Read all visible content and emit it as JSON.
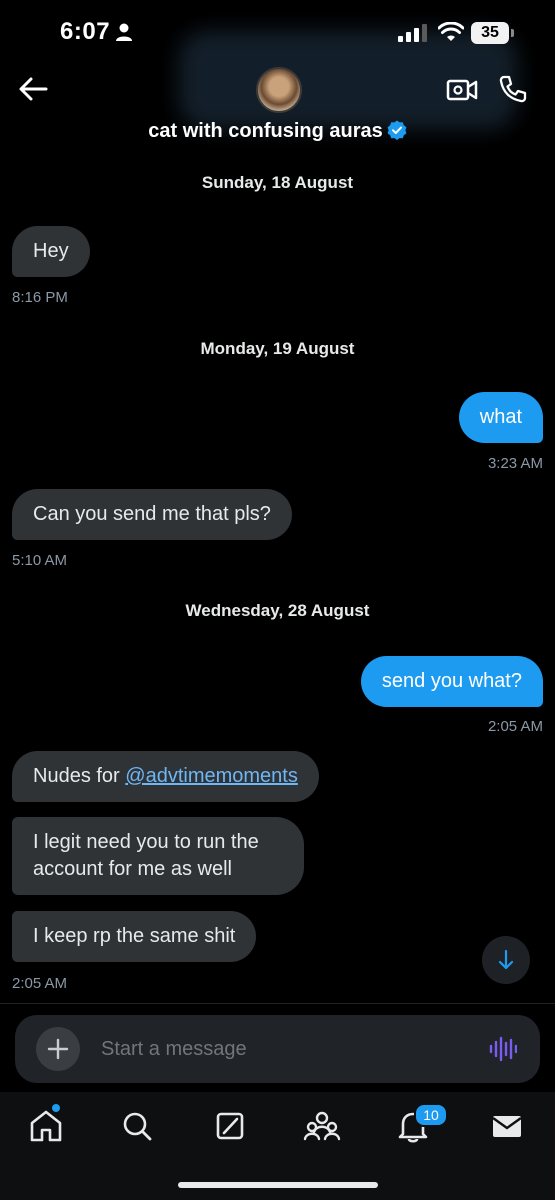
{
  "status_bar": {
    "time": "6:07",
    "battery": "35"
  },
  "header": {
    "contact_name": "cat with confusing auras"
  },
  "conversation": {
    "day1": {
      "date": "Sunday, 18 August",
      "msg1": "Hey",
      "time": "8:16 PM"
    },
    "day2": {
      "date": "Monday, 19 August",
      "sent1": "what",
      "sent_time": "3:23 AM",
      "recv1": "Can you send me that pls?",
      "recv_time": "5:10 AM"
    },
    "day3": {
      "date": "Wednesday, 28 August",
      "sent1": "send you what?",
      "sent_time": "2:05 AM",
      "recv1_prefix": "Nudes for ",
      "recv1_mention": "@advtimemoments",
      "recv2": "I legit need you to run the account for me as well",
      "recv3": "I keep rp the same shit",
      "recv_time": "2:05 AM"
    }
  },
  "composer": {
    "placeholder": "Start a message"
  },
  "nav": {
    "notifications_badge": "10",
    "items": [
      "home-icon",
      "search-icon",
      "grok-icon",
      "communities-icon",
      "bell-icon",
      "mail-icon"
    ]
  },
  "colors": {
    "accent": "#1d9bf0",
    "received_bubble": "#2f3336",
    "background": "#000000",
    "voice_accent": "#7b5cf0"
  }
}
